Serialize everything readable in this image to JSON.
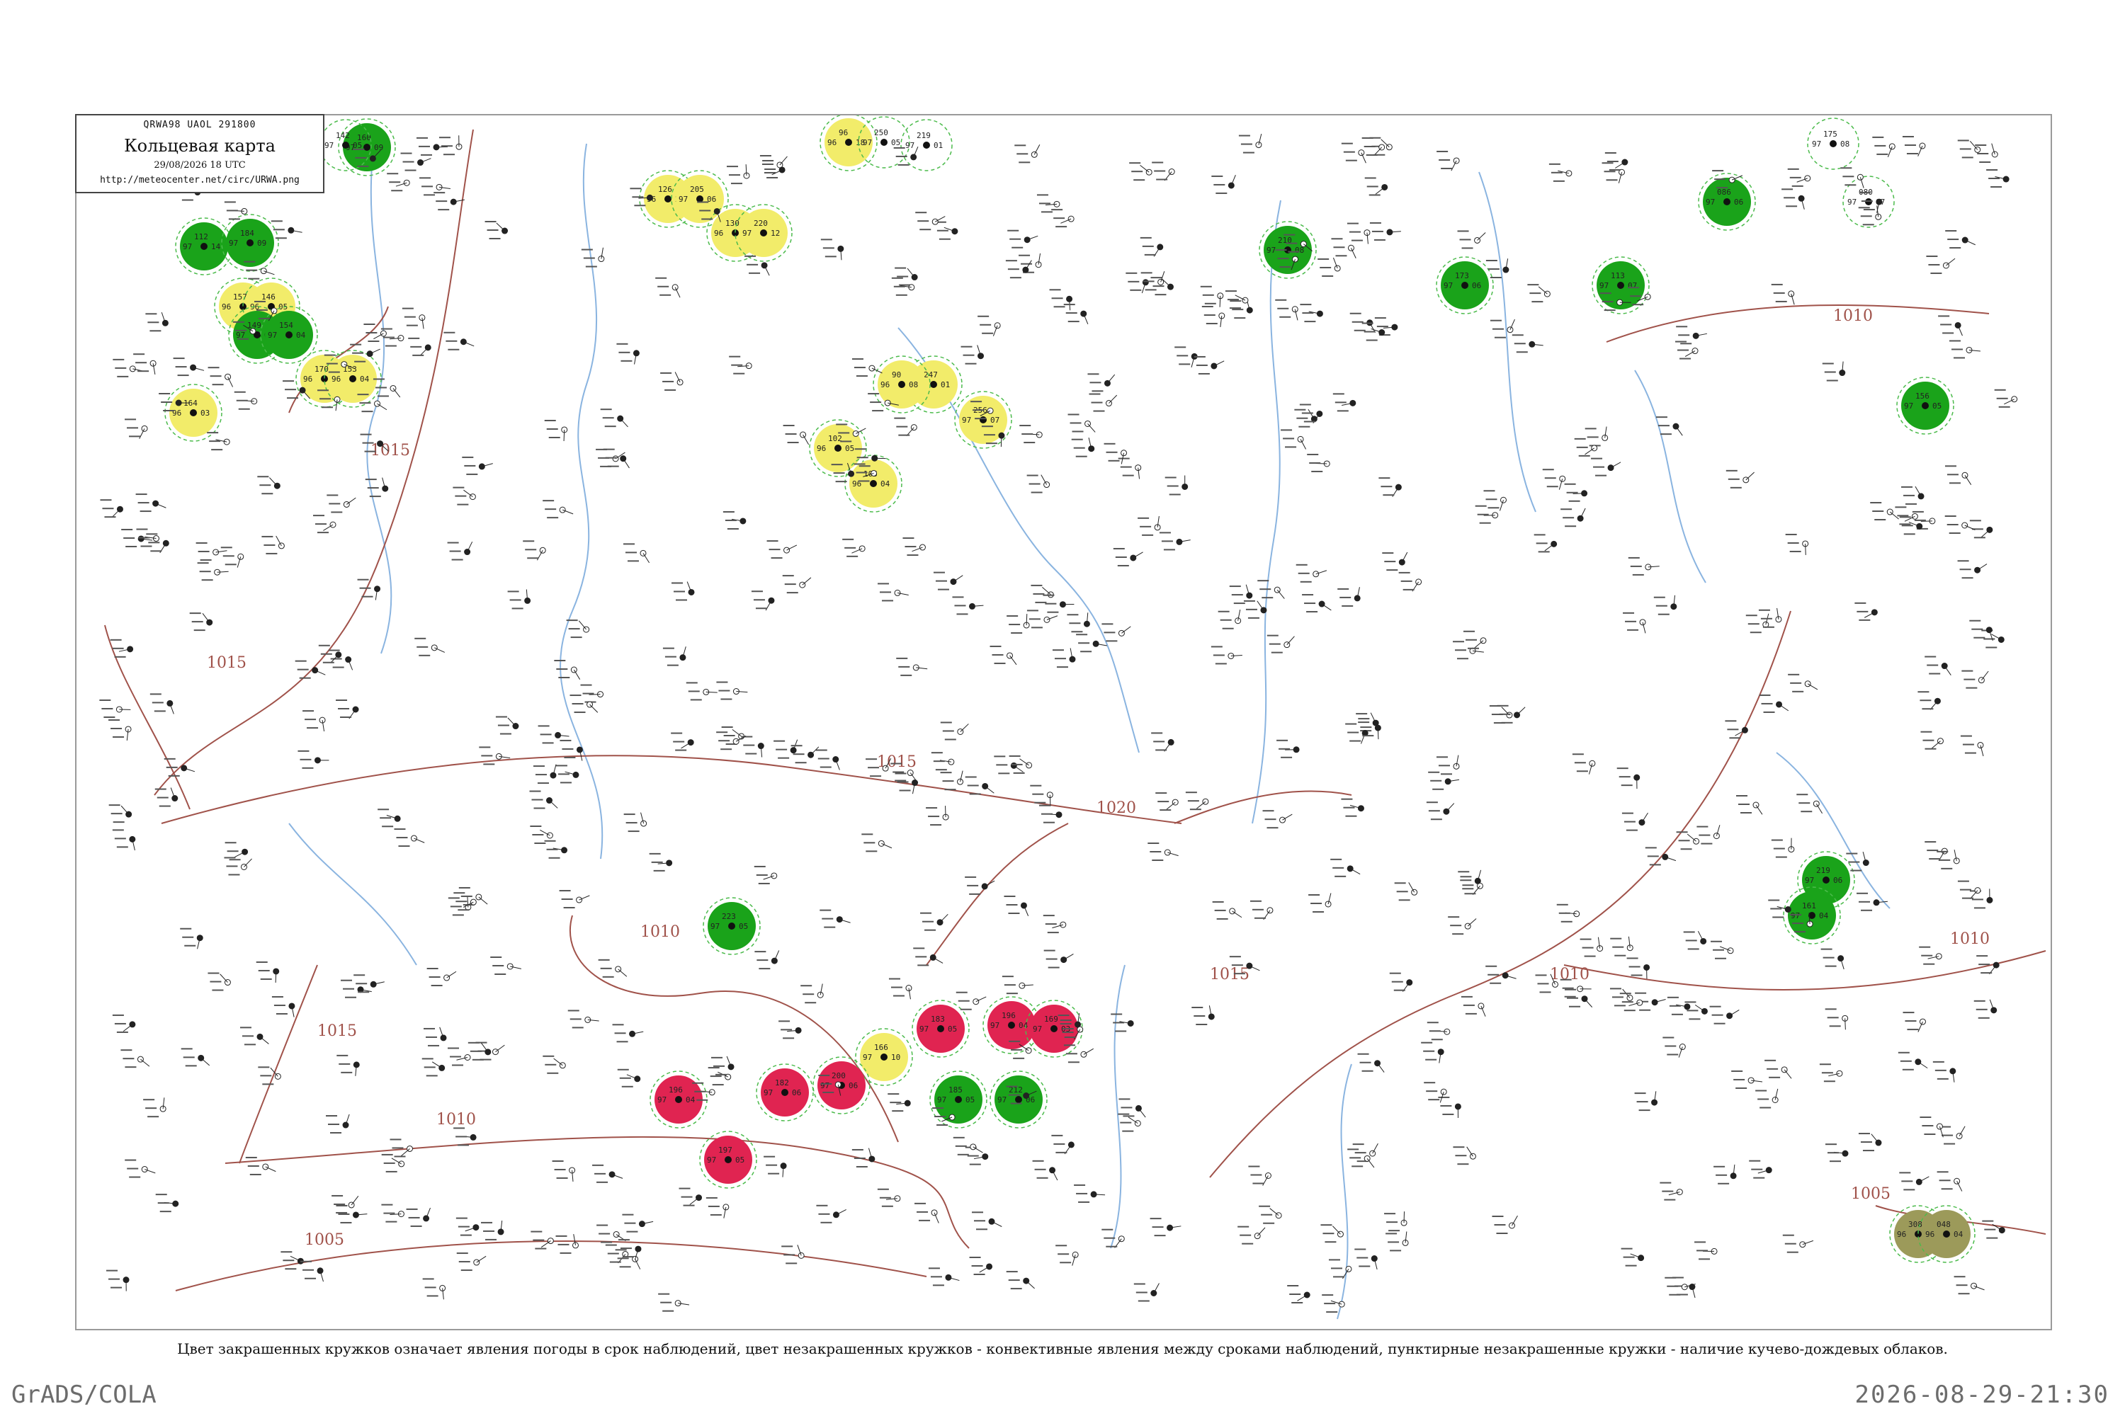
{
  "header": {
    "bulletin": "QRWA98  UAOL  291800",
    "title": "Кольцевая карта",
    "date": "29/08/2026 18 UTC",
    "url": "http://meteocenter.net/circ/URWA.png"
  },
  "caption": "Цвет закрашенных кружков означает явления погоды в срок наблюдений, цвет незакрашенных кружков - конвективные явления между сроками наблюдений, пунктирные незакрашенные кружки - наличие кучево-дождевых облаков.",
  "footer": {
    "left": "GrADS/COLA",
    "right": "2026-08-29-21:30"
  },
  "colors": {
    "frame": "#9a9a9a",
    "isobar": "#a0524a",
    "river": "#8ab4e0",
    "fog_green": "#1aa31a",
    "rain_red": "#e02451",
    "haze_yellow": "#f2ec6a",
    "drizzle_olive": "#9c9a5a",
    "cb_ring": "#4cbb4c"
  },
  "isobar_labels": [
    {
      "id": "isobar-1015-west",
      "text": "1015"
    },
    {
      "id": "isobar-1015-center",
      "text": "1015"
    },
    {
      "id": "isobar-1015-south",
      "text": "1015"
    },
    {
      "id": "isobar-1015-west2",
      "text": "1015"
    },
    {
      "id": "isobar-1010-center",
      "text": "1010"
    },
    {
      "id": "isobar-1010-south",
      "text": "1010"
    },
    {
      "id": "isobar-1005-south",
      "text": "1005"
    },
    {
      "id": "isobar-1020-center",
      "text": "1020"
    },
    {
      "id": "isobar-1015-east",
      "text": "1015"
    },
    {
      "id": "isobar-1010-east",
      "text": "1010"
    },
    {
      "id": "isobar-1010-far-east",
      "text": "1010"
    },
    {
      "id": "isobar-1010-northeast",
      "text": "1010"
    },
    {
      "id": "isobar-1005-southeast",
      "text": "1005"
    }
  ],
  "stations": [
    {
      "p": "160",
      "t": "97",
      "d": "09",
      "w": "fog"
    },
    {
      "p": "112",
      "t": "97",
      "d": "14",
      "w": "fog"
    },
    {
      "p": "172",
      "t": "97",
      "d": "12",
      "w": ""
    },
    {
      "p": "142",
      "t": "97",
      "d": "05",
      "w": ""
    },
    {
      "p": "126",
      "t": "96",
      "d": "23",
      "w": "haze"
    },
    {
      "p": "205",
      "t": "97",
      "d": "06",
      "w": "haze"
    },
    {
      "p": "130",
      "t": "96",
      "d": "02",
      "w": "haze"
    },
    {
      "p": "220",
      "t": "97",
      "d": "12",
      "w": "haze"
    },
    {
      "p": "96",
      "t": "96",
      "d": "18",
      "w": "haze"
    },
    {
      "p": "250",
      "t": "97",
      "d": "05",
      "w": ""
    },
    {
      "p": "219",
      "t": "97",
      "d": "01",
      "w": ""
    },
    {
      "p": "175",
      "t": "97",
      "d": "08",
      "w": "cb"
    },
    {
      "p": "086",
      "t": "97",
      "d": "06",
      "w": "fog"
    },
    {
      "p": "080",
      "t": "97",
      "d": "07",
      "w": "cb"
    },
    {
      "p": "184",
      "t": "97",
      "d": "09",
      "w": "fog"
    },
    {
      "p": "157",
      "t": "96",
      "d": "03",
      "w": "haze"
    },
    {
      "p": "146",
      "t": "96",
      "d": "05",
      "w": "haze"
    },
    {
      "p": "149",
      "t": "97",
      "d": "06",
      "w": "fog"
    },
    {
      "p": "154",
      "t": "97",
      "d": "04",
      "w": "fog"
    },
    {
      "p": "170",
      "t": "96",
      "d": "02",
      "w": "haze"
    },
    {
      "p": "153",
      "t": "96",
      "d": "04",
      "w": "haze"
    },
    {
      "p": "164",
      "t": "96",
      "d": "03",
      "w": "haze"
    },
    {
      "p": "247",
      "t": "97",
      "d": "01",
      "w": "haze"
    },
    {
      "p": "90",
      "t": "96",
      "d": "08",
      "w": "haze"
    },
    {
      "p": "256",
      "t": "97",
      "d": "07",
      "w": "haze"
    },
    {
      "p": "102",
      "t": "96",
      "d": "05",
      "w": "haze"
    },
    {
      "p": "105",
      "t": "96",
      "d": "04",
      "w": "haze"
    },
    {
      "p": "210",
      "t": "97",
      "d": "08",
      "w": "fog"
    },
    {
      "p": "173",
      "t": "97",
      "d": "06",
      "w": "fog"
    },
    {
      "p": "113",
      "t": "97",
      "d": "07",
      "w": "fog"
    },
    {
      "p": "156",
      "t": "97",
      "d": "05",
      "w": "fog"
    },
    {
      "p": "219",
      "t": "97",
      "d": "06",
      "w": "fog"
    },
    {
      "p": "161",
      "t": "97",
      "d": "04",
      "w": "fog"
    },
    {
      "p": "223",
      "t": "97",
      "d": "05",
      "w": "fog"
    },
    {
      "p": "196",
      "t": "97",
      "d": "04",
      "w": "rain"
    },
    {
      "p": "183",
      "t": "97",
      "d": "05",
      "w": "rain"
    },
    {
      "p": "169",
      "t": "97",
      "d": "03",
      "w": "rain"
    },
    {
      "p": "166",
      "t": "97",
      "d": "10",
      "w": "haze"
    },
    {
      "p": "200",
      "t": "97",
      "d": "06",
      "w": "rain"
    },
    {
      "p": "182",
      "t": "97",
      "d": "06",
      "w": "rain"
    },
    {
      "p": "196",
      "t": "97",
      "d": "04",
      "w": "rain"
    },
    {
      "p": "197",
      "t": "97",
      "d": "05",
      "w": "rain"
    },
    {
      "p": "185",
      "t": "97",
      "d": "05",
      "w": "fog"
    },
    {
      "p": "212",
      "t": "97",
      "d": "06",
      "w": "fog"
    },
    {
      "p": "308",
      "t": "96",
      "d": "04",
      "w": "drizzle"
    },
    {
      "p": "048",
      "t": "96",
      "d": "04",
      "w": "drizzle"
    }
  ]
}
